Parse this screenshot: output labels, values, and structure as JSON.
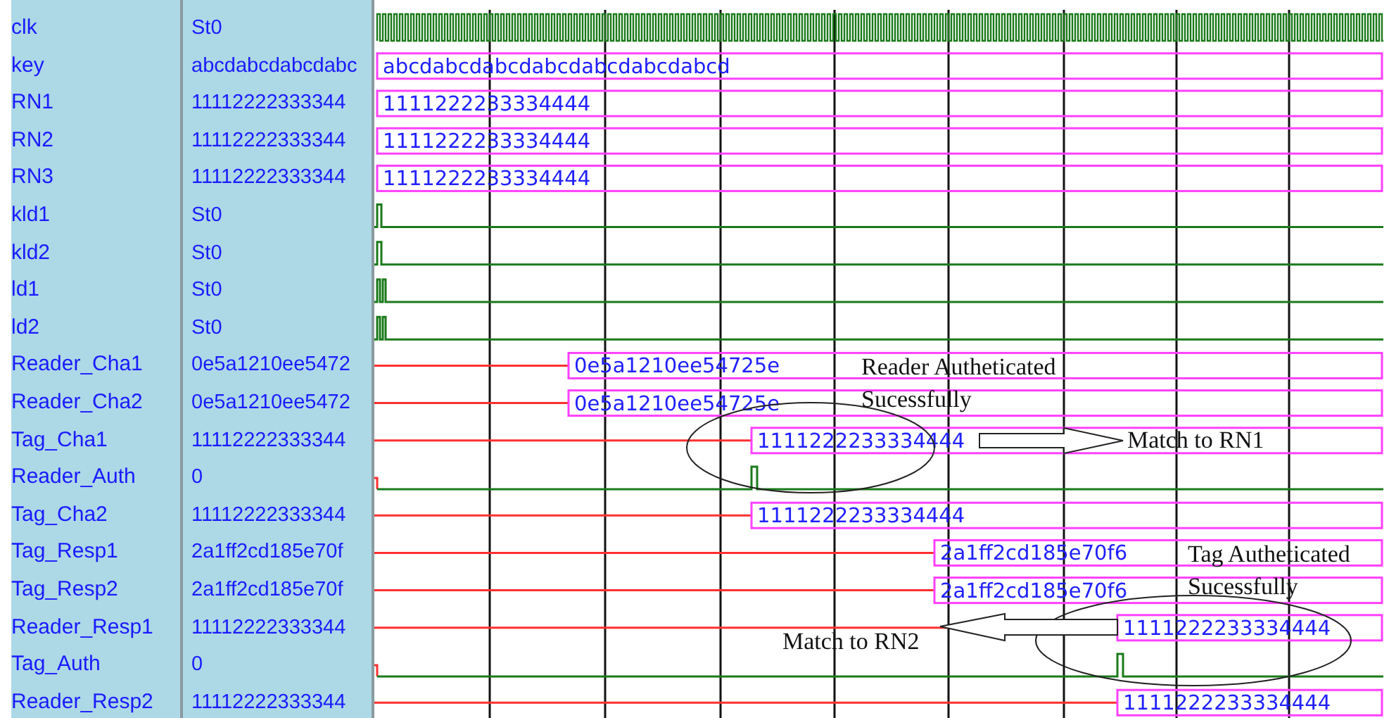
{
  "signals": [
    {
      "name": "clk",
      "value": "St0",
      "kind": "clock"
    },
    {
      "name": "key",
      "value": "abcdabcdabcdabc",
      "kind": "bus",
      "bus_text": "abcdabcdabcdabcdabcdabcdabcd"
    },
    {
      "name": "RN1",
      "value": "11112222333344",
      "kind": "bus",
      "bus_text": "1111222233334444"
    },
    {
      "name": "RN2",
      "value": "11112222333344",
      "kind": "bus",
      "bus_text": "1111222233334444"
    },
    {
      "name": "RN3",
      "value": "11112222333344",
      "kind": "bus",
      "bus_text": "1111222233334444"
    },
    {
      "name": "kld1",
      "value": "St0",
      "kind": "bit"
    },
    {
      "name": "kld2",
      "value": "St0",
      "kind": "bit"
    },
    {
      "name": "ld1",
      "value": "St0",
      "kind": "bit"
    },
    {
      "name": "ld2",
      "value": "St0",
      "kind": "bit"
    },
    {
      "name": "Reader_Cha1",
      "value": "0e5a1210ee5472",
      "kind": "bus",
      "bus_text": "0e5a1210ee54725e"
    },
    {
      "name": "Reader_Cha2",
      "value": "0e5a1210ee5472",
      "kind": "bus",
      "bus_text": "0e5a1210ee54725e"
    },
    {
      "name": "Tag_Cha1",
      "value": "11112222333344",
      "kind": "bus",
      "bus_text": "1111222233334444"
    },
    {
      "name": "Reader_Auth",
      "value": "0",
      "kind": "bit"
    },
    {
      "name": "Tag_Cha2",
      "value": "11112222333344",
      "kind": "bus",
      "bus_text": "1111222233334444"
    },
    {
      "name": "Tag_Resp1",
      "value": "2a1ff2cd185e70f",
      "kind": "bus",
      "bus_text": "2a1ff2cd185e70f6"
    },
    {
      "name": "Tag_Resp2",
      "value": "2a1ff2cd185e70f",
      "kind": "bus",
      "bus_text": "2a1ff2cd185e70f6"
    },
    {
      "name": "Reader_Resp1",
      "value": "11112222333344",
      "kind": "bus",
      "bus_text": "1111222233334444"
    },
    {
      "name": "Tag_Auth",
      "value": "0",
      "kind": "bit"
    },
    {
      "name": "Reader_Resp2",
      "value": "11112222333344",
      "kind": "bus",
      "bus_text": "1111222233334444"
    }
  ],
  "annotations": [
    {
      "text": "Reader Autheticated"
    },
    {
      "text": "Sucessfully"
    },
    {
      "text": "Match to RN1"
    },
    {
      "text": "Tag Autheticated"
    },
    {
      "text": "Sucessfully"
    },
    {
      "text": "Match to RN2"
    }
  ]
}
